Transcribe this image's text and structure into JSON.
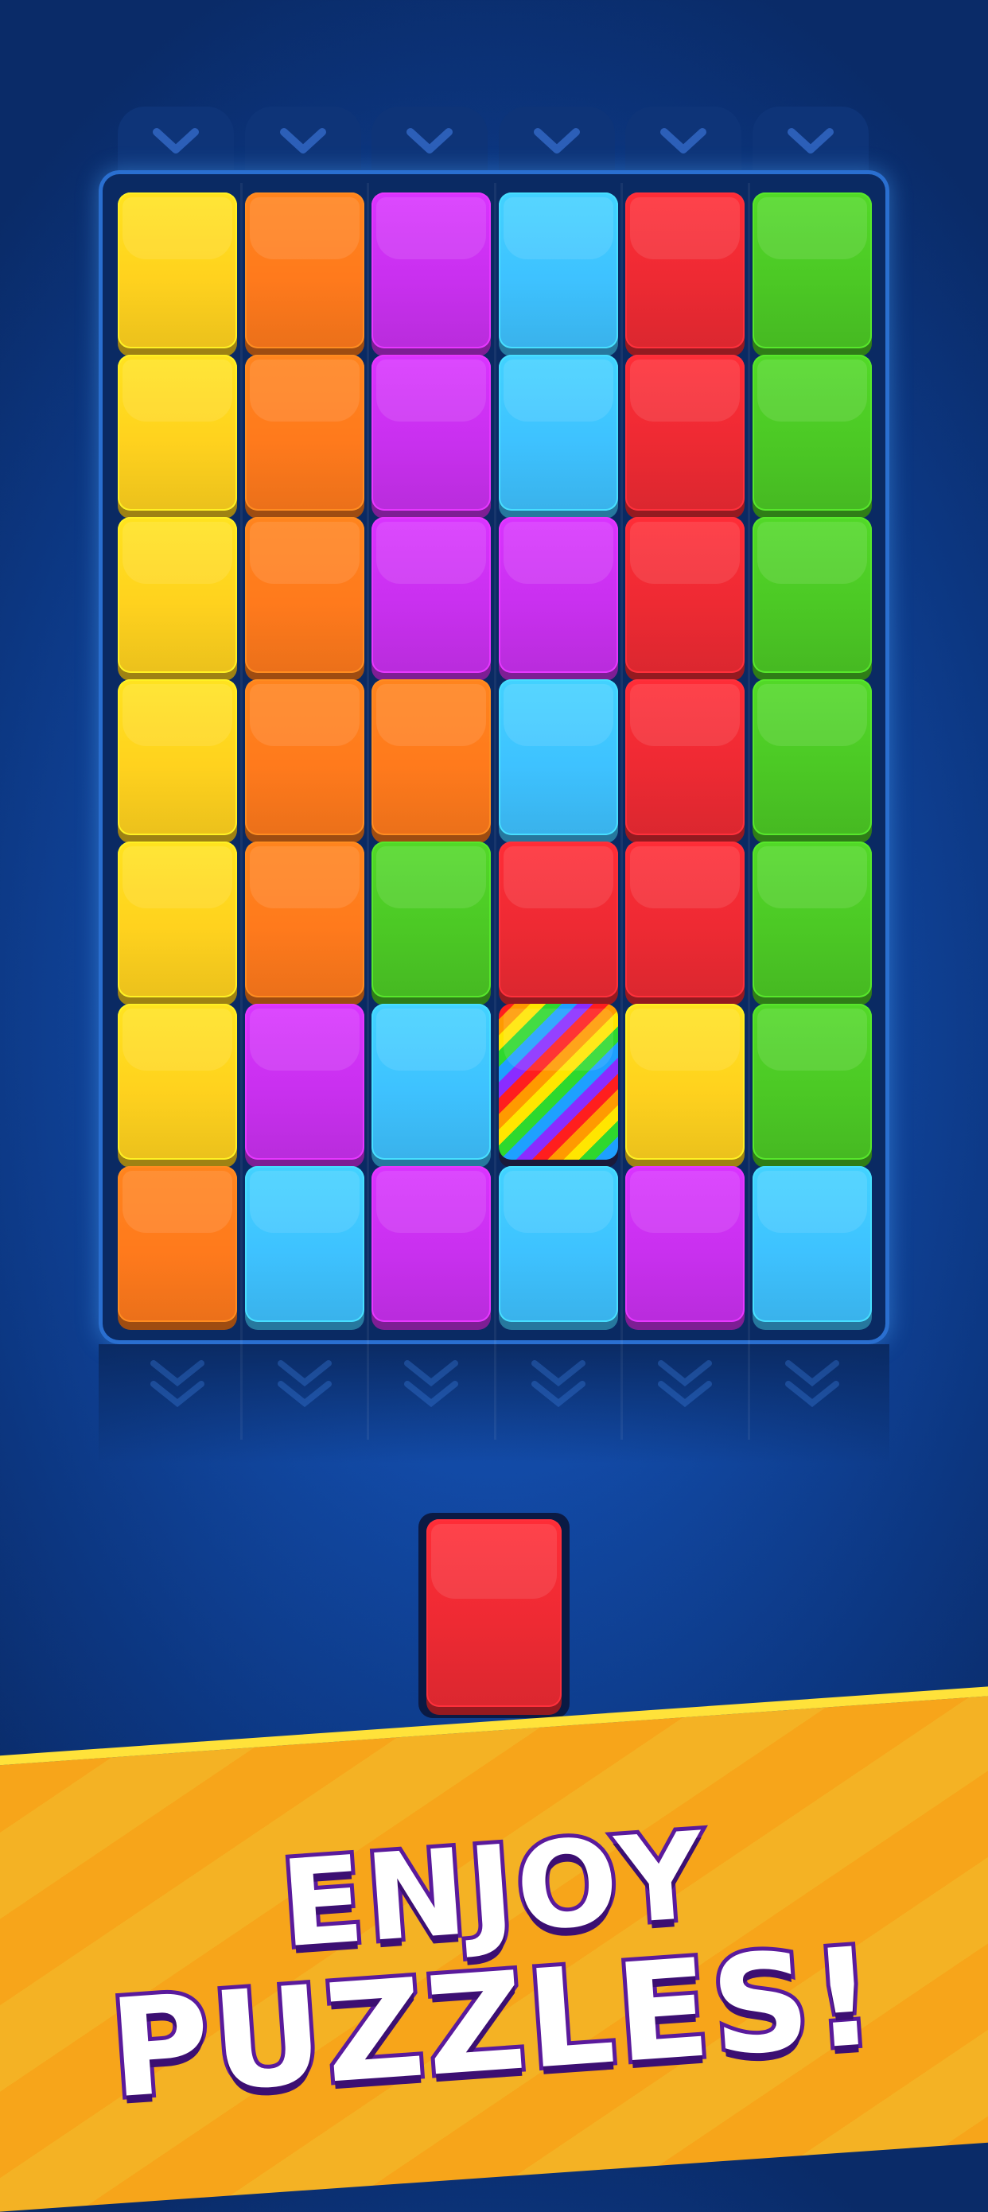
{
  "palette": {
    "yellow": "#ffd21e",
    "orange": "#ff7a1c",
    "purple": "#c930ef",
    "cyan": "#3ec2ff",
    "red": "#ee2a33",
    "green": "#4cc925",
    "rainbow": "rainbow"
  },
  "board": {
    "columns": 6,
    "rows": [
      [
        "yellow",
        "orange",
        "purple",
        "cyan",
        "red",
        "green"
      ],
      [
        "yellow",
        "orange",
        "purple",
        "cyan",
        "red",
        "green"
      ],
      [
        "yellow",
        "orange",
        "purple",
        "purple",
        "red",
        "green"
      ],
      [
        "yellow",
        "orange",
        "orange",
        "cyan",
        "red",
        "green"
      ],
      [
        "yellow",
        "orange",
        "green",
        "red",
        "red",
        "green"
      ],
      [
        "yellow",
        "purple",
        "cyan",
        "rainbow",
        "yellow",
        "green"
      ],
      [
        "orange",
        "cyan",
        "purple",
        "cyan",
        "purple",
        "cyan"
      ]
    ]
  },
  "next_tile": {
    "color": "red"
  },
  "column_tab_icon": "chevron-down-icon",
  "headline": {
    "line1": "ENJOY",
    "line2": "PUZZLES!"
  }
}
